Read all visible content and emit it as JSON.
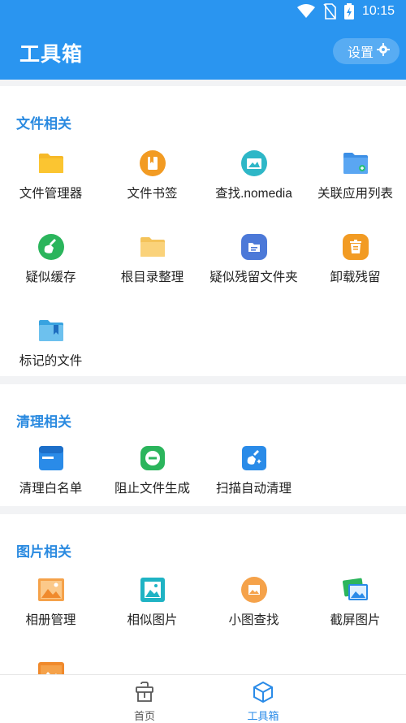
{
  "status_bar": {
    "time": "10:15"
  },
  "header": {
    "title": "工具箱",
    "settings_label": "设置"
  },
  "sections": [
    {
      "title": "文件相关",
      "items": [
        {
          "label": "文件管理器",
          "icon": "folder-icon"
        },
        {
          "label": "文件书签",
          "icon": "bookmark-icon"
        },
        {
          "label": "查找.nomedia",
          "icon": "image-search-icon"
        },
        {
          "label": "关联应用列表",
          "icon": "folder-link-icon"
        },
        {
          "label": "疑似缓存",
          "icon": "broom-icon"
        },
        {
          "label": "根目录整理",
          "icon": "folder-icon"
        },
        {
          "label": "疑似残留文件夹",
          "icon": "folder-file-icon"
        },
        {
          "label": "卸载残留",
          "icon": "trash-icon"
        },
        {
          "label": "标记的文件",
          "icon": "marked-folder-icon"
        }
      ]
    },
    {
      "title": "清理相关",
      "items": [
        {
          "label": "清理白名单",
          "icon": "whitelist-icon"
        },
        {
          "label": "阻止文件生成",
          "icon": "block-icon"
        },
        {
          "label": "扫描自动清理",
          "icon": "auto-clean-icon"
        }
      ]
    },
    {
      "title": "图片相关",
      "items": [
        {
          "label": "相册管理",
          "icon": "album-icon"
        },
        {
          "label": "相似图片",
          "icon": "similar-image-icon"
        },
        {
          "label": "小图查找",
          "icon": "small-image-icon"
        },
        {
          "label": "截屏图片",
          "icon": "screenshot-icon"
        }
      ]
    }
  ],
  "bottom_nav": [
    {
      "label": "首页",
      "icon": "home-icon",
      "active": false
    },
    {
      "label": "工具箱",
      "icon": "toolbox-icon",
      "active": true
    }
  ],
  "colors": {
    "primary": "#2a95f0",
    "section_title": "#2a8ae0",
    "background": "#f2f3f5"
  }
}
